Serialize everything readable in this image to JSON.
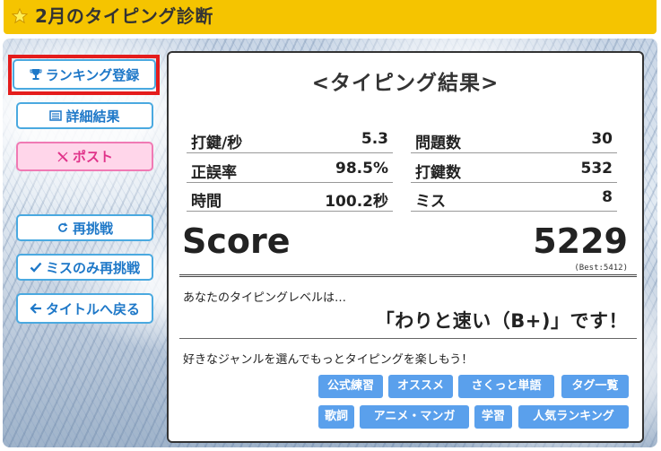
{
  "header": {
    "title": "2月のタイピング診断"
  },
  "sidebar": {
    "ranking": "ランキング登録",
    "details": "詳細結果",
    "post": "ポスト",
    "retry": "再挑戦",
    "retry_miss": "ミスのみ再挑戦",
    "back": "タイトルへ戻る"
  },
  "result": {
    "title": "<タイピング結果>",
    "stats_left": [
      {
        "label": "打鍵/秒",
        "value": "5.3"
      },
      {
        "label": "正誤率",
        "value": "98.5%"
      },
      {
        "label": "時間",
        "value": "100.2秒"
      }
    ],
    "stats_right": [
      {
        "label": "問題数",
        "value": "30"
      },
      {
        "label": "打鍵数",
        "value": "532"
      },
      {
        "label": "ミス",
        "value": "8"
      }
    ],
    "score_label": "Score",
    "score": "5229",
    "best": "(Best:5412)",
    "level_intro": "あなたのタイピングレベルは…",
    "level_result": "「わりと速い（B+)」です！",
    "genre_intro": "好きなジャンルを選んでもっとタイピングを楽しもう！",
    "genres_row1": [
      "公式練習",
      "オススメ",
      "さくっと単語",
      "タグ一覧"
    ],
    "genres_row2": [
      "歌詞",
      "アニメ・マンガ",
      "学習",
      "人気ランキング"
    ]
  },
  "colors": {
    "header": "#f5c400",
    "button_border": "#4aa9e0",
    "post_pink": "#ffd6ea",
    "chip": "#5aa0ec",
    "highlight": "#e41c1c"
  }
}
